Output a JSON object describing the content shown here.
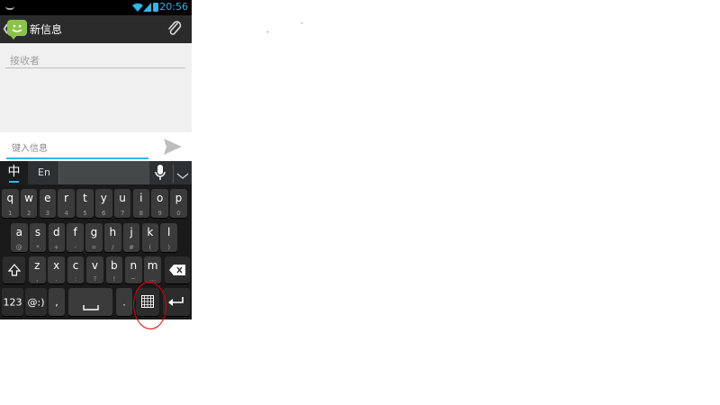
{
  "status": {
    "time": "20:56"
  },
  "actionbar": {
    "back_glyph": "❮",
    "title": "新信息"
  },
  "recipient": {
    "placeholder": "接收者"
  },
  "compose": {
    "placeholder": "键入信息"
  },
  "ime": {
    "mode_zh": "中",
    "mode_en": "En"
  },
  "keyboard": {
    "row1": [
      {
        "main": "q",
        "sub": "1"
      },
      {
        "main": "w",
        "sub": "2"
      },
      {
        "main": "e",
        "sub": "3"
      },
      {
        "main": "r",
        "sub": "4"
      },
      {
        "main": "t",
        "sub": "5"
      },
      {
        "main": "y",
        "sub": "6"
      },
      {
        "main": "u",
        "sub": "7"
      },
      {
        "main": "i",
        "sub": "8"
      },
      {
        "main": "o",
        "sub": "9"
      },
      {
        "main": "p",
        "sub": "0"
      }
    ],
    "row2": [
      {
        "main": "a",
        "sub": "@"
      },
      {
        "main": "s",
        "sub": "*"
      },
      {
        "main": "d",
        "sub": "+"
      },
      {
        "main": "f",
        "sub": "-"
      },
      {
        "main": "g",
        "sub": "="
      },
      {
        "main": "h",
        "sub": "/"
      },
      {
        "main": "j",
        "sub": "#"
      },
      {
        "main": "k",
        "sub": "("
      },
      {
        "main": "l",
        "sub": ")"
      }
    ],
    "row3": [
      {
        "main": "z",
        "sub": ","
      },
      {
        "main": "x",
        "sub": "."
      },
      {
        "main": "c",
        "sub": ":"
      },
      {
        "main": "v",
        "sub": "?"
      },
      {
        "main": "b",
        "sub": "!"
      },
      {
        "main": "n",
        "sub": "~"
      },
      {
        "main": "m",
        "sub": "…"
      }
    ],
    "numbers_label": "123",
    "emoticon_label": "@:)",
    "comma": ",",
    "period": "."
  },
  "colors": {
    "accent": "#33b5e5",
    "annotation": "#e00000"
  }
}
